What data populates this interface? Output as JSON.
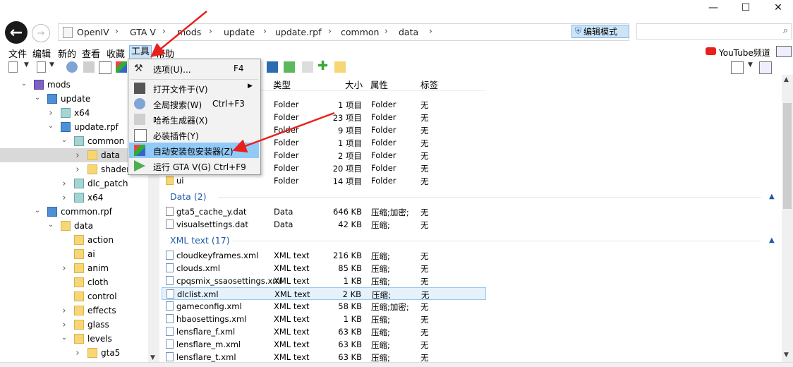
{
  "window": {
    "minimize": "—",
    "maximize": "☐",
    "close": "✕"
  },
  "address": {
    "crumbs": [
      "OpenIV",
      "GTA V",
      "mods",
      "update",
      "update.rpf",
      "common",
      "data"
    ],
    "edit_mode": "编辑模式",
    "search_placeholder": ""
  },
  "menubar": {
    "file": "文件",
    "edit": "编辑",
    "new": "新的",
    "view": "查看",
    "favorites": "收藏",
    "tools": "工具",
    "help": "帮助",
    "youtube": "YouTube频道"
  },
  "tools_menu": [
    {
      "label": "选项(U)...",
      "shortcut": "F4",
      "icon": "wrench-icon"
    },
    {
      "label": "打开文件于(V)",
      "shortcut": "",
      "icon": "folder-open-icon",
      "submenu": true
    },
    {
      "label": "全局搜索(W)",
      "shortcut": "Ctrl+F3",
      "icon": "globe-search-icon"
    },
    {
      "label": "哈希生成器(X)",
      "shortcut": "",
      "icon": "hash-icon"
    },
    {
      "label": "必装插件(Y)",
      "shortcut": "",
      "icon": "checkbox-icon"
    },
    {
      "label": "自动安装包安装器(Z)",
      "shortcut": "",
      "icon": "package-installer-icon",
      "highlighted": true
    },
    {
      "label": "运行 GTA V(G) Ctrl+F9",
      "shortcut": "",
      "icon": "run-icon"
    }
  ],
  "tree": [
    {
      "label": "mods",
      "indent": 0,
      "icon": "cube",
      "arrow": "v"
    },
    {
      "label": "update",
      "indent": 1,
      "icon": "rpf",
      "arrow": "v"
    },
    {
      "label": "x64",
      "indent": 2,
      "icon": "greyb",
      "arrow": ">"
    },
    {
      "label": "update.rpf",
      "indent": 2,
      "icon": "rpf",
      "arrow": "v"
    },
    {
      "label": "common",
      "indent": 3,
      "icon": "greyb",
      "arrow": "v"
    },
    {
      "label": "data",
      "indent": 4,
      "icon": "folder",
      "arrow": ">",
      "selected": true
    },
    {
      "label": "shaders",
      "indent": 4,
      "icon": "folder",
      "arrow": ">"
    },
    {
      "label": "dlc_patch",
      "indent": 3,
      "icon": "greyb",
      "arrow": ">"
    },
    {
      "label": "x64",
      "indent": 3,
      "icon": "greyb",
      "arrow": ">"
    },
    {
      "label": "common.rpf",
      "indent": 1,
      "icon": "rpf",
      "arrow": "v"
    },
    {
      "label": "data",
      "indent": 2,
      "icon": "folder",
      "arrow": "v"
    },
    {
      "label": "action",
      "indent": 3,
      "icon": "folder",
      "arrow": ""
    },
    {
      "label": "ai",
      "indent": 3,
      "icon": "folder",
      "arrow": ""
    },
    {
      "label": "anim",
      "indent": 3,
      "icon": "folder",
      "arrow": ">"
    },
    {
      "label": "cloth",
      "indent": 3,
      "icon": "folder",
      "arrow": ""
    },
    {
      "label": "control",
      "indent": 3,
      "icon": "folder",
      "arrow": ""
    },
    {
      "label": "effects",
      "indent": 3,
      "icon": "folder",
      "arrow": ">"
    },
    {
      "label": "glass",
      "indent": 3,
      "icon": "folder",
      "arrow": ">"
    },
    {
      "label": "levels",
      "indent": 3,
      "icon": "folder",
      "arrow": "v"
    },
    {
      "label": "gta5",
      "indent": 4,
      "icon": "folder",
      "arrow": ">"
    }
  ],
  "list": {
    "headers": {
      "type": "类型",
      "size": "大小",
      "attr": "属性",
      "tag": "标签"
    },
    "folders": [
      {
        "name": "",
        "type": "Folder",
        "size": "1 项目",
        "attr": "Folder",
        "tag": "无"
      },
      {
        "name": "",
        "type": "Folder",
        "size": "23 项目",
        "attr": "Folder",
        "tag": "无"
      },
      {
        "name": "",
        "type": "Folder",
        "size": "9 项目",
        "attr": "Folder",
        "tag": "无"
      },
      {
        "name": "",
        "type": "Folder",
        "size": "1 项目",
        "attr": "Folder",
        "tag": "无"
      },
      {
        "name": "",
        "type": "Folder",
        "size": "2 项目",
        "attr": "Folder",
        "tag": "无"
      },
      {
        "name": "",
        "type": "Folder",
        "size": "20 项目",
        "attr": "Folder",
        "tag": "无"
      },
      {
        "name": "ui",
        "type": "Folder",
        "size": "14 项目",
        "attr": "Folder",
        "tag": "无"
      }
    ],
    "data_group": "Data (2)",
    "data_files": [
      {
        "name": "gta5_cache_y.dat",
        "type": "Data",
        "size": "646 KB",
        "attr": "压缩;加密;",
        "tag": "无"
      },
      {
        "name": "visualsettings.dat",
        "type": "Data",
        "size": "42 KB",
        "attr": "压缩;",
        "tag": "无"
      }
    ],
    "xml_group": "XML text (17)",
    "xml_files": [
      {
        "name": "cloudkeyframes.xml",
        "type": "XML text",
        "size": "216 KB",
        "attr": "压缩;",
        "tag": "无"
      },
      {
        "name": "clouds.xml",
        "type": "XML text",
        "size": "85 KB",
        "attr": "压缩;",
        "tag": "无"
      },
      {
        "name": "cpqsmix_ssaosettings.xml",
        "type": "XML text",
        "size": "1 KB",
        "attr": "压缩;",
        "tag": "无"
      },
      {
        "name": "dlclist.xml",
        "type": "XML text",
        "size": "2 KB",
        "attr": "压缩;",
        "tag": "无",
        "selected": true
      },
      {
        "name": "gameconfig.xml",
        "type": "XML text",
        "size": "58 KB",
        "attr": "压缩;加密;",
        "tag": "无"
      },
      {
        "name": "hbaosettings.xml",
        "type": "XML text",
        "size": "1 KB",
        "attr": "压缩;",
        "tag": "无"
      },
      {
        "name": "lensflare_f.xml",
        "type": "XML text",
        "size": "63 KB",
        "attr": "压缩;",
        "tag": "无"
      },
      {
        "name": "lensflare_m.xml",
        "type": "XML text",
        "size": "63 KB",
        "attr": "压缩;",
        "tag": "无"
      },
      {
        "name": "lensflare_t.xml",
        "type": "XML text",
        "size": "63 KB",
        "attr": "压缩;",
        "tag": "无"
      }
    ]
  },
  "colors": {
    "accent": "#cde4f7",
    "highlight": "#91c9f7",
    "annotation": "#e8201d",
    "group_text": "#1e5aa8"
  }
}
